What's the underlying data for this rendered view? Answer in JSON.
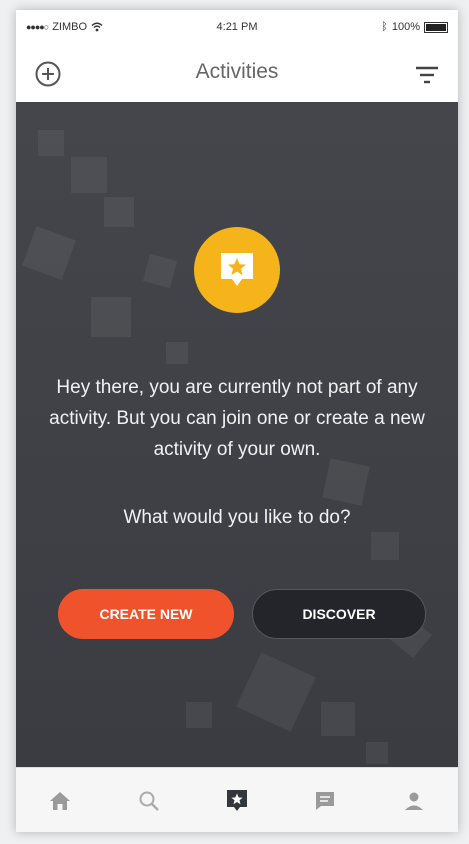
{
  "status_bar": {
    "carrier": "ZIMBO",
    "time": "4:21 PM",
    "battery": "100%"
  },
  "nav": {
    "title": "Activities",
    "add_icon": "plus-circle-icon",
    "filter_icon": "filter-icon"
  },
  "empty_state": {
    "icon": "activity-star-icon",
    "message": "Hey there, you are currently not part of any activity. But you can join one or create a new activity of your own.",
    "question": "What would you like to do?"
  },
  "actions": {
    "create_label": "CREATE NEW",
    "discover_label": "DISCOVER"
  },
  "tab_bar": {
    "tabs": [
      {
        "icon": "home-icon"
      },
      {
        "icon": "search-icon"
      },
      {
        "icon": "activity-icon",
        "active": true
      },
      {
        "icon": "chat-icon"
      },
      {
        "icon": "profile-icon"
      }
    ]
  },
  "colors": {
    "accent_orange": "#f0532c",
    "icon_yellow": "#f4b41a",
    "background_dark": "#3c3e44"
  }
}
